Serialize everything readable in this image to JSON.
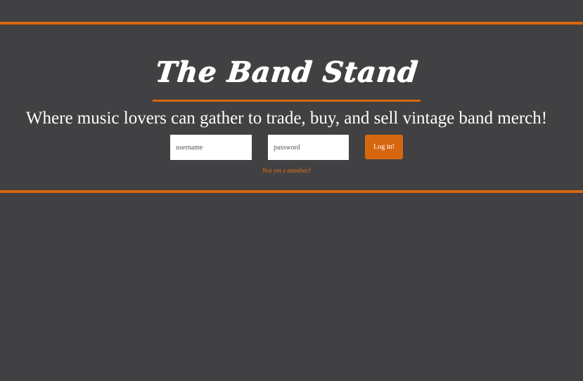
{
  "header": {
    "title": "The Band Stand",
    "tagline": "Where music lovers can gather to trade, buy, and sell vintage band merch!"
  },
  "login": {
    "username_placeholder": "username",
    "password_placeholder": "password",
    "submit_label": "Log in!",
    "signup_link": "Not yet a member?"
  },
  "colors": {
    "background": "#414042",
    "accent": "#d7670f",
    "text": "#ffffff"
  }
}
